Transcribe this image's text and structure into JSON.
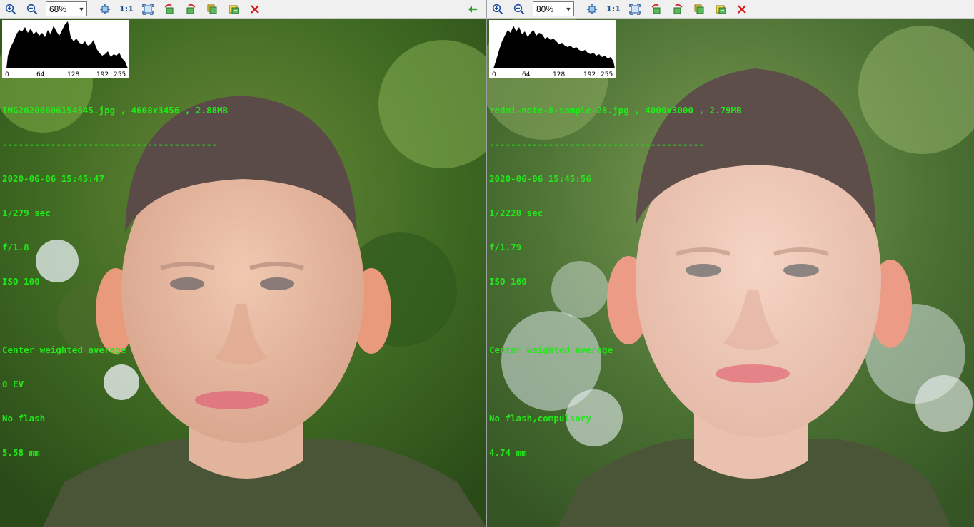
{
  "left_pane": {
    "zoom": "68%",
    "one_to_one": "1:1",
    "histogram_ticks": [
      "0",
      "64",
      "128",
      "192",
      "255"
    ],
    "info": {
      "file_line": "IMG20200606154545.jpg , 4608x3456 , 2.88MB",
      "separator": "----------------------------------------",
      "datetime": "2020-06-06 15:45:47",
      "shutter": "1/279 sec",
      "aperture": "f/1.8",
      "iso": "ISO 100",
      "metering": "Center weighted average",
      "exposure_bias": "0 EV",
      "flash": "No flash",
      "focal_length": "5.58 mm"
    }
  },
  "right_pane": {
    "zoom": "80%",
    "one_to_one": "1:1",
    "histogram_ticks": [
      "0",
      "64",
      "128",
      "192",
      "255"
    ],
    "info": {
      "file_line": "redmi-note-8-sample-28.jpg , 4000x3000 , 2.79MB",
      "separator": "----------------------------------------",
      "datetime": "2020-06-06 15:45:56",
      "shutter": "1/2228 sec",
      "aperture": "f/1.79",
      "iso": "ISO 160",
      "metering": "Center weighted average",
      "flash": "No flash,compulsory",
      "focal_length": "4.74 mm"
    }
  },
  "toolbar_icons": [
    "zoom-in-icon",
    "zoom-out-icon",
    "fit-width-icon",
    "one-to-one",
    "fit-window-icon",
    "rotate-left-icon",
    "rotate-right-icon",
    "copy-image-icon",
    "save-image-icon",
    "close-icon",
    "back-arrow-icon"
  ],
  "colors": {
    "info_text": "#22e81a",
    "toolbar_bg": "#f0f0f0",
    "close": "#d0161a",
    "back_arrow": "#2aa52a"
  }
}
